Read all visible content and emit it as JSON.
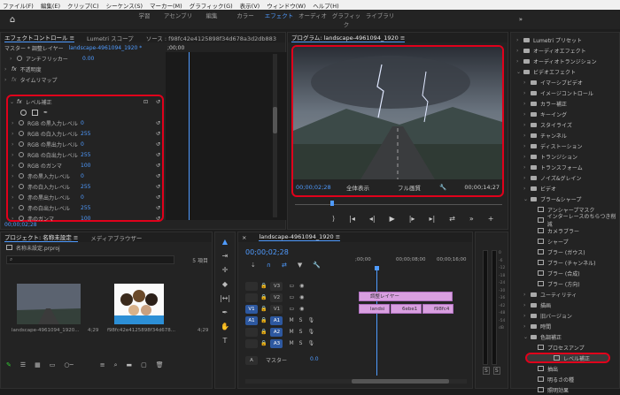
{
  "menu": [
    "ファイル(F)",
    "編集(E)",
    "クリップ(C)",
    "シーケンス(S)",
    "マーカー(M)",
    "グラフィック(G)",
    "表示(V)",
    "ウィンドウ(W)",
    "ヘルプ(H)"
  ],
  "workspaces": [
    "学習",
    "アセンブリ",
    "編集",
    "カラー",
    "エフェクト",
    "オーディオ",
    "グラフィック",
    "ライブラリ"
  ],
  "workspace_more": "»",
  "effect_controls": {
    "tabs": [
      "エフェクトコントロール ≡",
      "Lumetri スコープ",
      "ソース : f98fc42e4125898f34d678a3d2db883"
    ],
    "master": "マスター * 調整レイヤー",
    "clip": "landscape-4961094_1920 *",
    "time": ";00;00",
    "anti_flicker_label": "アンチフリッカー",
    "anti_flicker_value": "0.00",
    "opacity_label": "不透明度",
    "timeremap_label": "タイムリマップ",
    "level_title": "レベル補正",
    "params": [
      {
        "label": "RGB の黒入力レベル",
        "value": "0"
      },
      {
        "label": "RGB の白入力レベル",
        "value": "255"
      },
      {
        "label": "RGB の黒出力レベル",
        "value": "0"
      },
      {
        "label": "RGB の白出力レベル",
        "value": "255"
      },
      {
        "label": "RGB のガンマ",
        "value": "100"
      },
      {
        "label": "赤の黒入力レベル",
        "value": "0"
      },
      {
        "label": "赤の白入力レベル",
        "value": "255"
      },
      {
        "label": "赤の黒出力レベル",
        "value": "0"
      },
      {
        "label": "赤の白出力レベル",
        "value": "255"
      },
      {
        "label": "赤のガンマ",
        "value": "100"
      }
    ],
    "timecode": "00;00;02;28"
  },
  "program": {
    "title": "プログラム: landscape-4961094_1920 ≡",
    "timecode": "00;00;02;28",
    "zoom": "全体表示",
    "quality": "フル画質",
    "duration": "00;00;14;27"
  },
  "effects_tree": [
    {
      "label": "Lumetri プリセット",
      "folder": true
    },
    {
      "label": "オーディオエフェクト",
      "folder": true
    },
    {
      "label": "オーディオトランジション",
      "folder": true
    },
    {
      "label": "ビデオエフェクト",
      "folder": true,
      "open": true
    },
    {
      "label": "イマーシブビデオ",
      "folder": true,
      "indent": 1
    },
    {
      "label": "イメージコントロール",
      "folder": true,
      "indent": 1
    },
    {
      "label": "カラー補正",
      "folder": true,
      "indent": 1
    },
    {
      "label": "キーイング",
      "folder": true,
      "indent": 1
    },
    {
      "label": "スタイライズ",
      "folder": true,
      "indent": 1
    },
    {
      "label": "チャンネル",
      "folder": true,
      "indent": 1
    },
    {
      "label": "ディストーション",
      "folder": true,
      "indent": 1
    },
    {
      "label": "トランジション",
      "folder": true,
      "indent": 1
    },
    {
      "label": "トランスフォーム",
      "folder": true,
      "indent": 1
    },
    {
      "label": "ノイズ&グレイン",
      "folder": true,
      "indent": 1
    },
    {
      "label": "ビデオ",
      "folder": true,
      "indent": 1
    },
    {
      "label": "ブラー&シャープ",
      "folder": true,
      "indent": 1,
      "open": true
    },
    {
      "label": "アンシャープマスク",
      "indent": 2
    },
    {
      "label": "インターレースのちらつき削減",
      "indent": 2
    },
    {
      "label": "カメラブラー",
      "indent": 2
    },
    {
      "label": "シャープ",
      "indent": 2
    },
    {
      "label": "ブラー (ガウス)",
      "indent": 2
    },
    {
      "label": "ブラー (チャンネル)",
      "indent": 2
    },
    {
      "label": "ブラー (合成)",
      "indent": 2
    },
    {
      "label": "ブラー (方向)",
      "indent": 2
    },
    {
      "label": "ユーティリティ",
      "folder": true,
      "indent": 1
    },
    {
      "label": "描画",
      "folder": true,
      "indent": 1
    },
    {
      "label": "旧バージョン",
      "folder": true,
      "indent": 1
    },
    {
      "label": "時間",
      "folder": true,
      "indent": 1
    },
    {
      "label": "色調補正",
      "folder": true,
      "indent": 1,
      "open": true
    },
    {
      "label": "プロセスアンプ",
      "indent": 2
    },
    {
      "label": "レベル補正",
      "indent": 2,
      "selected": true
    },
    {
      "label": "抽出",
      "indent": 2
    },
    {
      "label": "明るさの種",
      "indent": 2
    },
    {
      "label": "照明効果",
      "indent": 2
    }
  ],
  "project": {
    "tabs": [
      "プロジェクト: 名称未設定 ≡",
      "メディアブラウザー"
    ],
    "file": "名称未設定.prproj",
    "count": "5 項目",
    "item1_name": "landscape-4961094_1920...",
    "item1_duration": "4;29",
    "item2_name": "f98fc42e4125898f34d678...",
    "item2_duration": "4;29"
  },
  "timeline": {
    "tab": "landscape-4961094_1920 ≡",
    "timecode": "00;00;02;28",
    "ruler": [
      ";00;00",
      "00;00;08;00",
      "00;00;16;00"
    ],
    "tracks": [
      {
        "id": "V3",
        "type": "video"
      },
      {
        "id": "V2",
        "type": "video"
      },
      {
        "id": "V1",
        "type": "video",
        "src": "V1"
      },
      {
        "id": "A1",
        "type": "audio",
        "src": "A1"
      },
      {
        "id": "A2",
        "type": "audio"
      },
      {
        "id": "A3",
        "type": "audio"
      }
    ],
    "adj_clip": "調整レイヤー",
    "v1_clips": [
      "landsi",
      "6ebe1",
      "f98fc4"
    ],
    "master_label": "マスター",
    "master_value": "0.0",
    "meter_labels": [
      "S",
      "S"
    ]
  },
  "colors": {
    "accent": "#4f9bff",
    "highlight": "#e0001b",
    "clip": "#d99fe0"
  }
}
